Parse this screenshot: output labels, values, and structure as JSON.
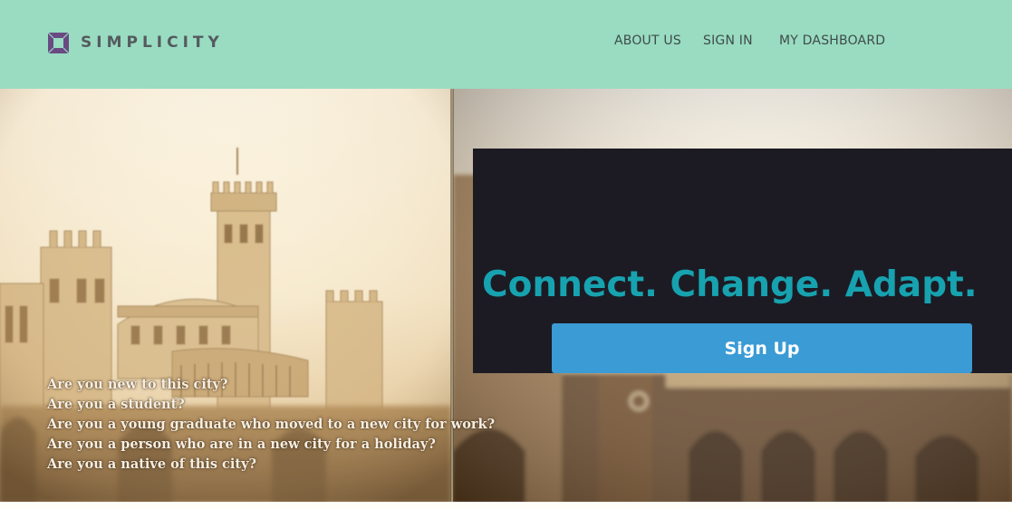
{
  "brand": {
    "name": "SIMPLICITY",
    "icon": "square-frame-logo-icon",
    "color": "#6a4a82"
  },
  "nav": {
    "about": "ABOUT US",
    "signin": "SIGN IN",
    "dashboard": "MY DASHBOARD"
  },
  "hero": {
    "questions": [
      "Are you new to this city?",
      "Are you a student?",
      "Are you a young graduate who moved to a new city for work?",
      "Are you a person who are in a new city for a holiday?",
      "Are you a native of this city?"
    ],
    "tagline": "Connect. Change. Adapt.",
    "signup_label": "Sign Up"
  },
  "colors": {
    "header_bg": "#99dcc2",
    "card_bg": "#1c1b24",
    "tagline": "#17a2b0",
    "button": "#3a9bd5",
    "sepia": "#e9cf9f"
  }
}
